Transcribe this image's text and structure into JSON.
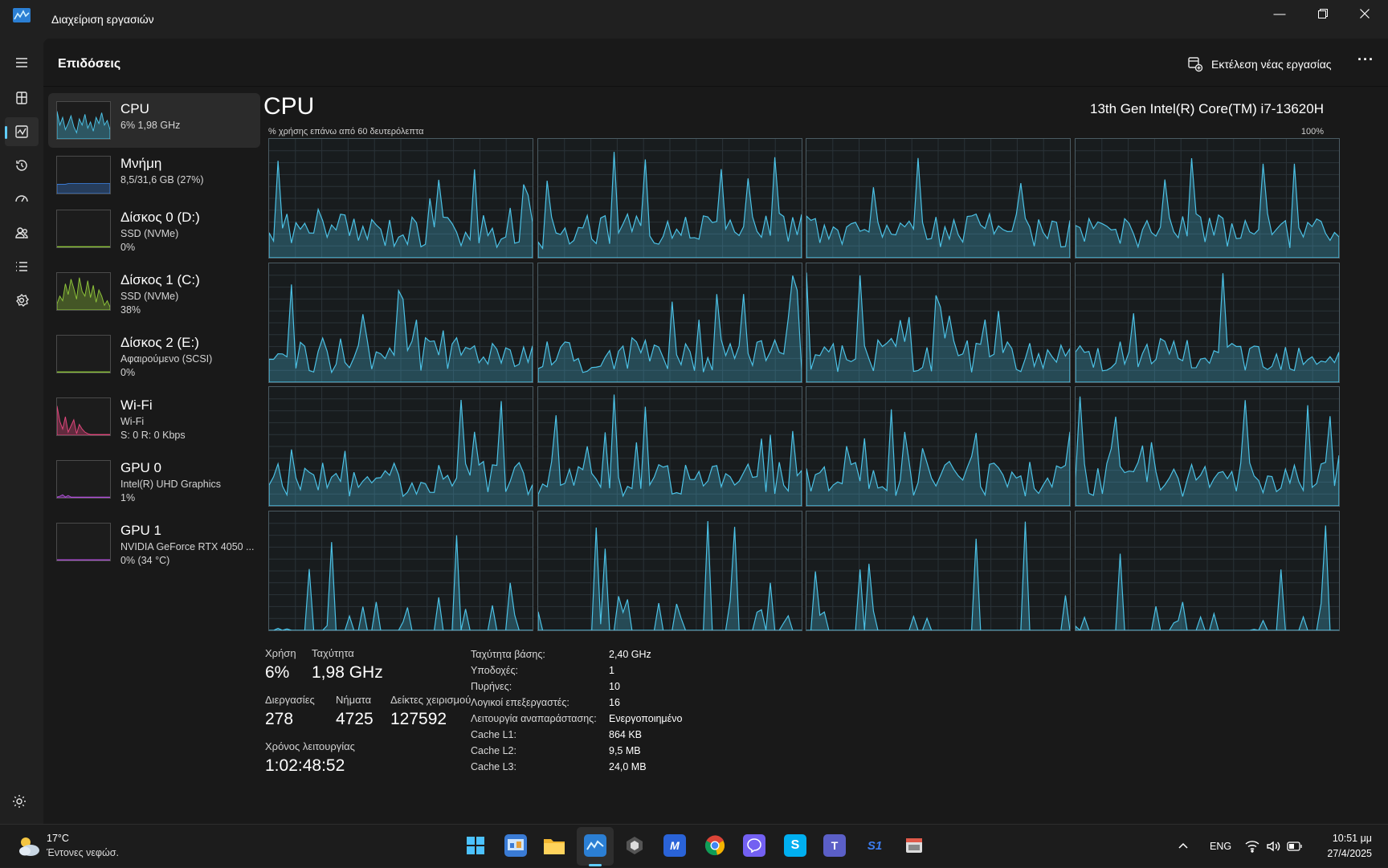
{
  "window": {
    "title": "Διαχείριση εργασιών",
    "minimize": "—",
    "restore": "❐",
    "close": "✕"
  },
  "header": {
    "page_title": "Επιδόσεις",
    "run_task_label": "Εκτέλεση νέας εργασίας",
    "more_label": "···"
  },
  "nav": [
    "menu-icon",
    "processes-icon",
    "performance-icon",
    "app-history-icon",
    "startup-apps-icon",
    "users-icon",
    "details-icon",
    "services-icon",
    "settings-icon"
  ],
  "sidebar": {
    "items": [
      {
        "name": "CPU",
        "sub1": "6%  1,98 GHz",
        "sub2": "",
        "color": "#4cc2e6",
        "usage": 6
      },
      {
        "name": "Μνήμη",
        "sub1": "8,5/31,6 GB (27%)",
        "sub2": "",
        "color": "#3a7bd5",
        "usage": 27
      },
      {
        "name": "Δίσκος 0 (D:)",
        "sub1": "SSD (NVMe)",
        "sub2": "0%",
        "color": "#8ec43a",
        "usage": 0
      },
      {
        "name": "Δίσκος 1 (C:)",
        "sub1": "SSD (NVMe)",
        "sub2": "38%",
        "color": "#8ec43a",
        "usage": 38
      },
      {
        "name": "Δίσκος 2 (E:)",
        "sub1": "Αφαιρούμενο (SCSI)",
        "sub2": "0%",
        "color": "#8ec43a",
        "usage": 0
      },
      {
        "name": "Wi-Fi",
        "sub1": "Wi-Fi",
        "sub2": "S: 0 R: 0 Kbps",
        "color": "#e2477d",
        "usage": 0
      },
      {
        "name": "GPU 0",
        "sub1": "Intel(R) UHD Graphics",
        "sub2": "1%",
        "color": "#b050d8",
        "usage": 1
      },
      {
        "name": "GPU 1",
        "sub1": "NVIDIA GeForce RTX 4050 ...",
        "sub2": "0% (34 °C)",
        "color": "#b050d8",
        "usage": 0
      }
    ]
  },
  "cpu": {
    "title": "CPU",
    "model": "13th Gen Intel(R) Core(TM) i7-13620H",
    "graph_caption": "% χρήσης επάνω από 60 δευτερόλεπτα",
    "graph_max": "100%",
    "accent": "#4cc2e6",
    "logical_processor_graphs": 16
  },
  "stats": {
    "usage_label": "Χρήση",
    "usage_value": "6%",
    "speed_label": "Ταχύτητα",
    "speed_value": "1,98 GHz",
    "processes_label": "Διεργασίες",
    "processes_value": "278",
    "threads_label": "Νήματα",
    "threads_value": "4725",
    "handles_label": "Δείκτες χειρισμού",
    "handles_value": "127592",
    "uptime_label": "Χρόνος λειτουργίας",
    "uptime_value": "1:02:48:52"
  },
  "specs": [
    {
      "label": "Ταχύτητα βάσης:",
      "value": "2,40 GHz"
    },
    {
      "label": "Υποδοχές:",
      "value": "1"
    },
    {
      "label": "Πυρήνες:",
      "value": "10"
    },
    {
      "label": "Λογικοί επεξεργαστές:",
      "value": "16"
    },
    {
      "label": "Λειτουργία αναπαράστασης:",
      "value": "Ενεργοποιημένο"
    },
    {
      "label": "Cache L1:",
      "value": "864 KB"
    },
    {
      "label": "Cache L2:",
      "value": "9,5 MB"
    },
    {
      "label": "Cache L3:",
      "value": "24,0 MB"
    }
  ],
  "taskbar": {
    "weather_temp": "17°C",
    "weather_cond": "Έντονες νεφώσ.",
    "apps": [
      "start-icon",
      "control-panel-icon",
      "file-explorer-icon",
      "task-manager-icon",
      "unity-hub-icon",
      "app-icon",
      "chrome-icon",
      "viber-icon",
      "skype-icon",
      "teams-icon",
      "s1-icon",
      "app-window-icon"
    ],
    "lang": "ENG",
    "time": "10:51 μμ",
    "date": "27/4/2025"
  }
}
